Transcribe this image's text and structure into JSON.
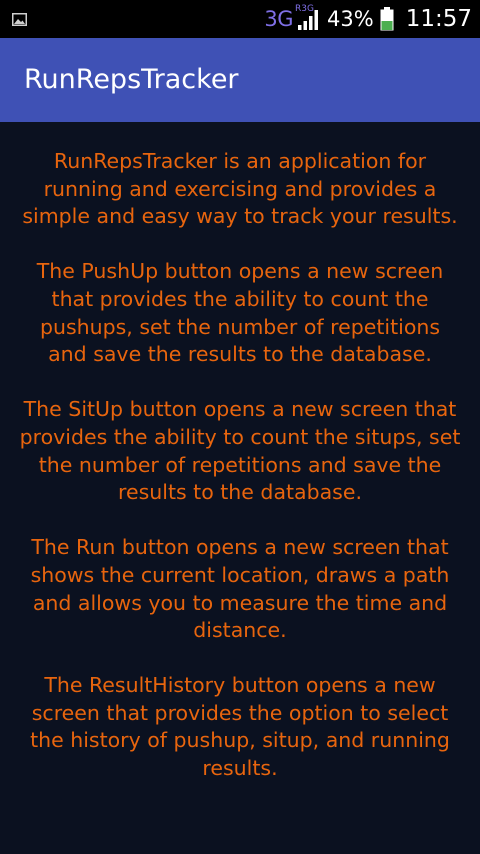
{
  "status_bar": {
    "network_type": "3G",
    "network_subtype": "R3G",
    "battery_percent": "43%",
    "time": "11:57",
    "icons": [
      "image-notification-icon",
      "signal-icon",
      "battery-icon"
    ],
    "battery_level": 0.43,
    "battery_color": "#4caf50"
  },
  "app_bar": {
    "title": "RunRepsTracker",
    "color": "#3f51b5"
  },
  "content": {
    "background": "#0b1120",
    "text_color": "#e8650e",
    "description": "RunRepsTracker is an application for running and exercising and provides a simple and easy way to track your results.\n\nThe PushUp button opens a new screen that provides the ability to count the pushups, set the number of repetitions and save the results to the database.\n\nThe SitUp button opens a new screen that provides the ability to count the situps, set the number of repetitions and save the results to the database.\n\nThe Run button opens a new screen that shows the current location, draws a path and allows you to measure the time and distance.\n\nThe ResultHistory button opens a new screen that provides the option to select the history of pushup, situp, and running results."
  }
}
